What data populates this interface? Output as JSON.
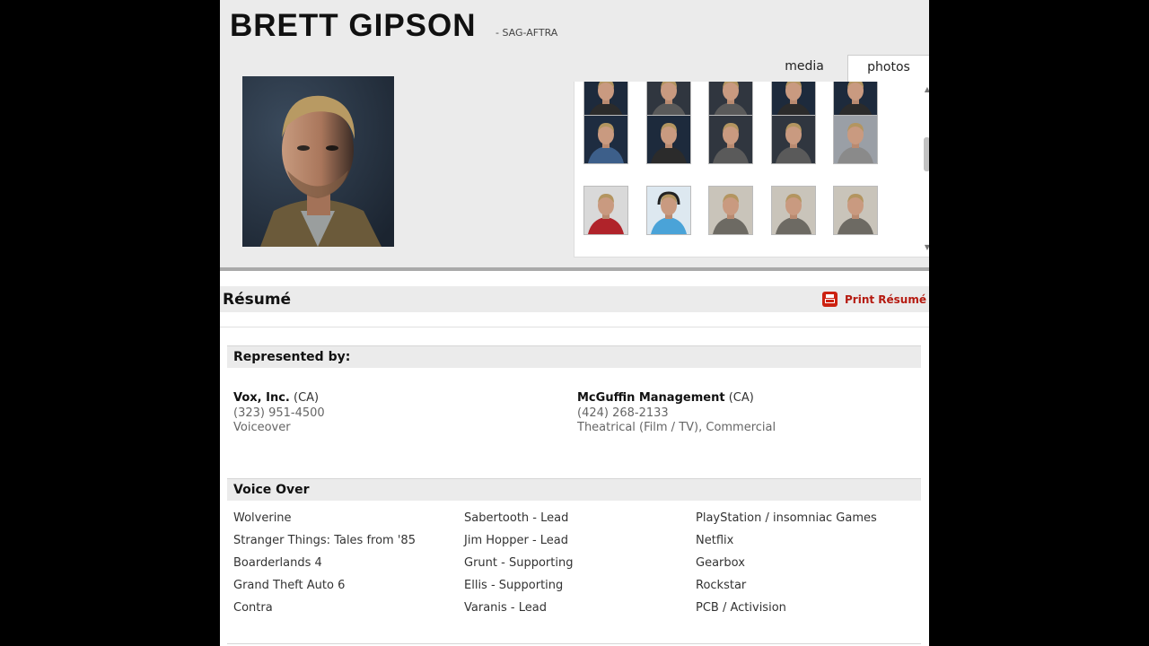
{
  "actor": {
    "name": "BRETT GIPSON",
    "union": "- SAG-AFTRA"
  },
  "tabs": [
    {
      "label": "media"
    },
    {
      "label": "photos",
      "active": true
    }
  ],
  "gallery": {
    "rows": [
      [
        "dark-shirt",
        "plaid-shirt",
        "plaid-shirt",
        "dark-shirt",
        "dark-shirt"
      ],
      [
        "blue-shirt",
        "dark-shirt",
        "plaid-shirt",
        "plaid-shirt",
        "grey-shirt"
      ],
      [
        "red-plaid-shirt",
        "blue-headphones",
        "suit",
        "suit",
        "suit"
      ]
    ]
  },
  "resume": {
    "title": "Résumé",
    "print_label": "Print Résumé"
  },
  "represented_by": {
    "heading": "Represented by:",
    "agencies": [
      {
        "name": "Vox, Inc.",
        "location": "(CA)",
        "phone": "(323) 951-4500",
        "type": "Voiceover"
      },
      {
        "name": "McGuffin Management",
        "location": "(CA)",
        "phone": "(424) 268-2133",
        "type": "Theatrical (Film / TV), Commercial"
      }
    ]
  },
  "voice_over": {
    "heading": "Voice Over",
    "credits": [
      {
        "project": "Wolverine",
        "role": "Sabertooth - Lead",
        "company": "PlayStation / insomniac Games"
      },
      {
        "project": "Stranger Things: Tales from '85",
        "role": "Jim Hopper - Lead",
        "company": "Netflix"
      },
      {
        "project": "Boarderlands 4",
        "role": "Grunt - Supporting",
        "company": "Gearbox"
      },
      {
        "project": "Grand Theft Auto 6",
        "role": "Ellis - Supporting",
        "company": "Rockstar"
      },
      {
        "project": "Contra",
        "role": "Varanis - Lead",
        "company": "PCB / Activision"
      }
    ]
  },
  "colors": {
    "accent_red": "#b51a10",
    "header_bg": "#ebebeb"
  }
}
